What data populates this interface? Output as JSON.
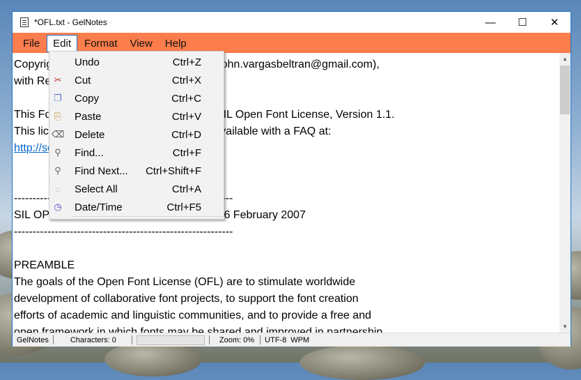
{
  "window": {
    "title": "*OFL.txt - GelNotes",
    "minimize_glyph": "—",
    "maximize_glyph": "☐",
    "close_glyph": "✕"
  },
  "menubar": {
    "items": [
      "File",
      "Edit",
      "Format",
      "View",
      "Help"
    ],
    "active": "Edit",
    "background": "#fd7d4d"
  },
  "editor": {
    "lines": [
      "Copyright (c) 2010, John Vargas Beltrán (john.vargasbeltran@gmail.com),",
      "with Reserved Font Name Plumbino.",
      "",
      "This Font Software is licensed under the SIL Open Font License, Version 1.1.",
      "This license is copied below, and is also available with a FAQ at:",
      "http://scripts.sil.org/OFL",
      "",
      "",
      "-----------------------------------------------------------",
      "SIL OPEN FONT LICENSE Version 1.1 - 26 February 2007",
      "-----------------------------------------------------------",
      "",
      "PREAMBLE",
      "The goals of the Open Font License (OFL) are to stimulate worldwide",
      "development of collaborative font projects, to support the font creation",
      "efforts of academic and linguistic communities, and to provide a free and",
      "open framework in which fonts may be shared and improved in partnership"
    ],
    "link_line_index": 5
  },
  "edit_menu": {
    "items": [
      {
        "label": "Undo",
        "shortcut": "Ctrl+Z",
        "icon": "undo-icon"
      },
      {
        "label": "Cut",
        "shortcut": "Ctrl+X",
        "icon": "scissors-icon"
      },
      {
        "label": "Copy",
        "shortcut": "Ctrl+C",
        "icon": "copy-icon"
      },
      {
        "label": "Paste",
        "shortcut": "Ctrl+V",
        "icon": "paste-icon"
      },
      {
        "label": "Delete",
        "shortcut": "Ctrl+D",
        "icon": "delete-icon"
      },
      {
        "label": "Find...",
        "shortcut": "Ctrl+F",
        "icon": "magnifier-icon"
      },
      {
        "label": "Find Next...",
        "shortcut": "Ctrl+Shift+F",
        "icon": "magnifier-icon"
      },
      {
        "label": "Select All",
        "shortcut": "Ctrl+A",
        "icon": "select-all-icon"
      },
      {
        "label": "Date/Time",
        "shortcut": "Ctrl+F5",
        "icon": "clock-icon"
      }
    ]
  },
  "statusbar": {
    "app_name": "GelNotes",
    "characters": "Characters: 0",
    "zoom": "Zoom: 0%",
    "encoding": "UTF-8",
    "mode": "WPM"
  },
  "colors": {
    "window_border": "#1c73c9",
    "link": "#0066cc"
  }
}
